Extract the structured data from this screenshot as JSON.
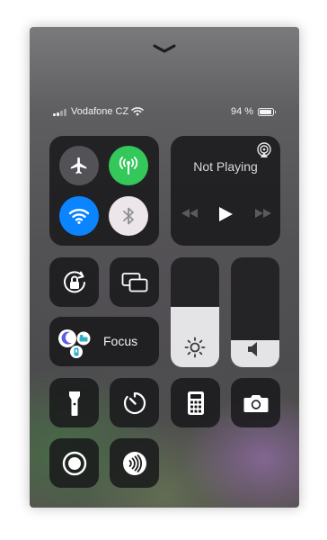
{
  "status_bar": {
    "carrier": "Vodafone CZ",
    "battery_percent": "94 %",
    "battery_level": 0.94,
    "signal_bars": 2
  },
  "connectivity": {
    "airplane_mode": {
      "icon": "airplane-icon",
      "active": false
    },
    "cellular_data": {
      "icon": "cellular-antenna-icon",
      "active": true,
      "color": "#34c759"
    },
    "wifi": {
      "icon": "wifi-icon",
      "active": true,
      "color": "#0a84ff"
    },
    "bluetooth": {
      "icon": "bluetooth-icon",
      "active": false
    }
  },
  "now_playing": {
    "label": "Not Playing",
    "airplay_icon": "airplay-icon",
    "controls": [
      "previous-icon",
      "play-icon",
      "next-icon"
    ]
  },
  "controls": {
    "orientation_lock_icon": "orientation-lock-icon",
    "screen_mirroring_icon": "screen-mirroring-icon",
    "focus_label": "Focus",
    "flashlight_icon": "flashlight-icon",
    "timer_icon": "timer-icon",
    "calculator_icon": "calculator-icon",
    "camera_icon": "camera-icon",
    "screen_recording_icon": "screen-recording-icon",
    "nfc_reader_icon": "nfc-icon"
  },
  "sliders": {
    "brightness": {
      "level": 0.55,
      "icon": "sun-icon"
    },
    "volume": {
      "level": 0.25,
      "icon": "speaker-icon"
    }
  },
  "colors": {
    "tile": "#161618",
    "cellular_active": "#34c759",
    "wifi_active": "#0a84ff",
    "slider_fill": "#e4e4e6"
  }
}
